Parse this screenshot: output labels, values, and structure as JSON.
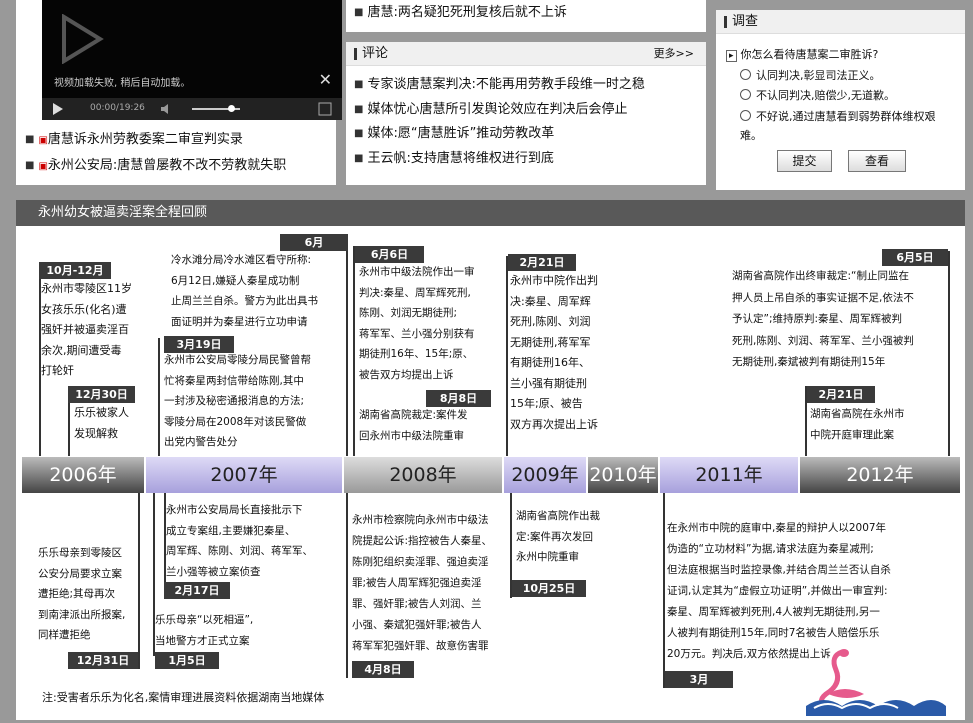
{
  "video": {
    "error": "视频加载失败, 稍后自动加载。",
    "time": "00:00/19:26",
    "close": "✕"
  },
  "video_links": [
    "唐慧诉永州劳教委案二审宣判实录",
    "永州公安局:唐慧曾屡教不改不劳教就失职"
  ],
  "top_news": "唐慧:两名疑犯死刑复核后就不上诉",
  "comment": {
    "title": "评论",
    "more": "更多>>",
    "items": [
      "专家谈唐慧案判决:不能再用劳教手段维一时之稳",
      "媒体忧心唐慧所引发舆论效应在判决后会停止",
      "媒体:愿“唐慧胜诉”推动劳教改革",
      "王云帆:支持唐慧将维权进行到底"
    ]
  },
  "survey": {
    "title": "调查",
    "question": "你怎么看待唐慧案二审胜诉?",
    "options": [
      "认同判决,彰显司法正义。",
      "不认同判决,赔偿少,无道歉。",
      "不好说,通过唐慧看到弱势群体维权艰难。"
    ],
    "submit": "提交",
    "view": "查看"
  },
  "timeline": {
    "title": "永州幼女被逼卖淫案全程回顾",
    "years": [
      "2006年",
      "2007年",
      "2008年",
      "2009年",
      "2010年",
      "2011年",
      "2012年"
    ],
    "tags": {
      "oct_dec": "10月-12月",
      "dec30": "12月30日",
      "jun": "6月",
      "mar19": "3月19日",
      "jun6": "6月6日",
      "aug8": "8月8日",
      "feb21": "2月21日",
      "jun5": "6月5日",
      "feb21b": "2月21日",
      "dec31": "12月31日",
      "feb17": "2月17日",
      "jan5": "1月5日",
      "apr8": "4月8日",
      "oct25": "10月25日",
      "mar": "3月"
    },
    "above": {
      "e1": [
        "永州市零陵区11岁",
        "女孩乐乐(化名)遭",
        "强奸并被逼卖淫百",
        "余次,期间遭受毒",
        "打轮奸"
      ],
      "e2": [
        "乐乐被家人",
        "发现解救"
      ],
      "e3": [
        "冷水滩分局冷水滩区看守所称:",
        "6月12日,嫌疑人秦星成功制",
        "止周兰兰自杀。警方为此出具书",
        "面证明并为秦星进行立功申请"
      ],
      "e4": [
        "永州市公安局零陵分局民警曾帮",
        "忙将秦星两封信带给陈刚,其中",
        "一封涉及秘密通报消息的方法;",
        "零陵分局在2008年对该民警做",
        "出党内警告处分"
      ],
      "e5": [
        "永州市中级法院作出一审",
        "判决:秦星、周军辉死刑,",
        "陈刚、刘润无期徒刑;",
        "蒋军军、兰小强分别获有",
        "期徒刑16年、15年;原、",
        "被告双方均提出上诉"
      ],
      "e6": [
        "湖南省高院裁定:案件发",
        "回永州市中级法院重审"
      ],
      "e7": [
        "永州市中院作出判",
        "决:秦星、周军辉",
        "死刑,陈刚、刘润",
        "无期徒刑,蒋军军",
        "有期徒刑16年、",
        "兰小强有期徒刑",
        "15年;原、被告",
        "双方再次提出上诉"
      ],
      "e8": [
        "湖南省高院作出终审裁定:“制止同监在",
        "押人员上吊自杀的事实证据不足,依法不",
        "予认定”;维持原判:秦星、周军辉被判",
        "死刑,陈刚、刘润、蒋军军、兰小强被判",
        "无期徒刑,秦斌被判有期徒刑15年"
      ],
      "e9": [
        "湖南省高院在永州市",
        "中院开庭审理此案"
      ]
    },
    "below": {
      "b1": [
        "乐乐母亲到零陵区",
        "公安分局要求立案",
        "遭拒绝;其母再次",
        "到南津派出所报案,",
        "同样遭拒绝"
      ],
      "b2": [
        "永州市公安局局长直接批示下",
        "成立专案组,主要嫌犯秦星、",
        "周军辉、陈刚、刘润、蒋军军、",
        "兰小强等被立案侦查"
      ],
      "b3": [
        "乐乐母亲“以死相逼”,",
        "当地警方才正式立案"
      ],
      "b4": [
        "永州市检察院向永州市中级法",
        "院提起公诉:指控被告人秦星、",
        "陈刚犯组织卖淫罪、强迫卖淫",
        "罪;被告人周军辉犯强迫卖淫",
        "罪、强奸罪;被告人刘润、兰",
        "小强、秦斌犯强奸罪;被告人",
        "蒋军军犯强奸罪、故意伤害罪"
      ],
      "b5": [
        "湖南省高院作出裁",
        "定:案件再次发回",
        "永州中院重审"
      ],
      "b6": [
        "在永州市中院的庭审中,秦星的辩护人以2007年",
        "伪造的“立功材料”为据,请求法庭为秦星减刑;",
        "但法庭根据当时监控录像,并结合周兰兰否认自杀",
        "证词,认定其为“虚假立功证明”,并做出一审宣判:",
        "秦星、周军辉被判死刑,4人被判无期徒刑,另一",
        "人被判有期徒刑15年,同时7名被告人赔偿乐乐",
        "20万元。判决后,双方依然提出上诉"
      ]
    },
    "note": "注:受害者乐乐为化名,案情审理进展资料依据湖南当地媒体"
  }
}
